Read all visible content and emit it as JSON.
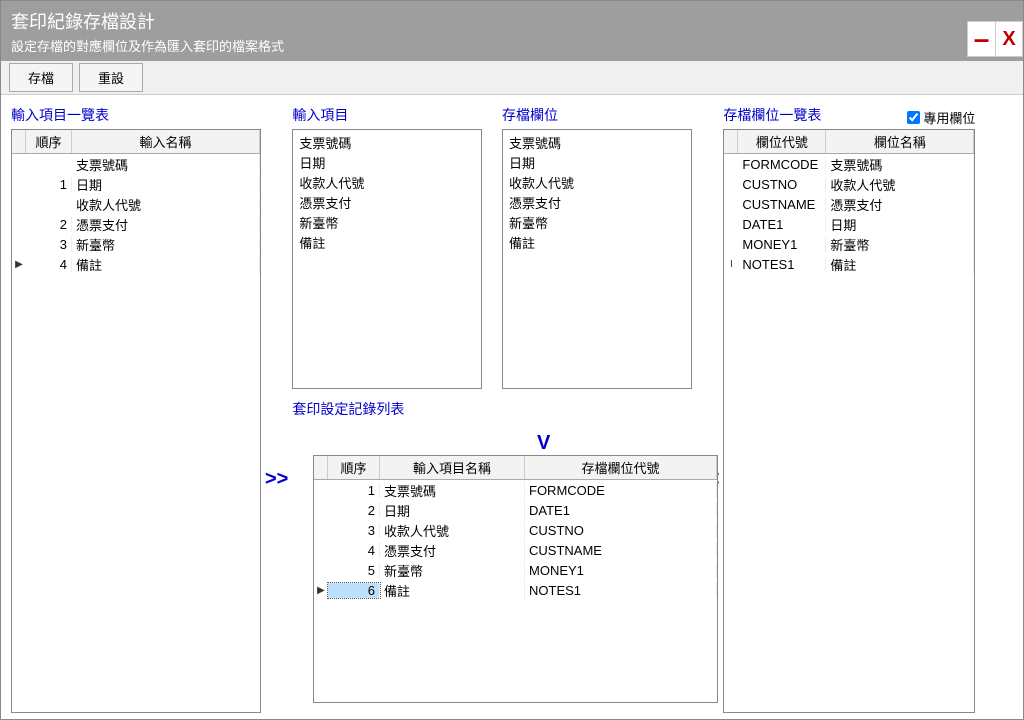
{
  "window": {
    "title": "套印紀錄存檔設計",
    "subtitle": "設定存檔的對應欄位及作為匯入套印的檔案格式",
    "minimize": "–",
    "close": "X"
  },
  "toolbar": {
    "save_label": "存檔",
    "reset_label": "重設"
  },
  "panels": {
    "input_list_title": "輸入項目一覽表",
    "input_items_title": "輸入項目",
    "save_fields_title": "存檔欄位",
    "field_list_title": "存檔欄位一覽表",
    "record_list_title": "套印設定記錄列表",
    "dedicated_field_label": "專用欄位",
    "dedicated_field_checked": true
  },
  "operators": {
    "push_right": ">>",
    "tilde": "~",
    "push_left": "<<",
    "down": "V"
  },
  "input_list": {
    "headers": {
      "order": "順序",
      "name": "輸入名稱"
    },
    "rows": [
      {
        "order": "",
        "name": "支票號碼",
        "ind": ""
      },
      {
        "order": "1",
        "name": "日期",
        "ind": ""
      },
      {
        "order": "",
        "name": "收款人代號",
        "ind": ""
      },
      {
        "order": "2",
        "name": "憑票支付",
        "ind": ""
      },
      {
        "order": "3",
        "name": "新臺幣",
        "ind": ""
      },
      {
        "order": "4",
        "name": "備註",
        "ind": "▶"
      }
    ]
  },
  "input_items": [
    "支票號碼",
    "日期",
    "收款人代號",
    "憑票支付",
    "新臺幣",
    "備註"
  ],
  "save_fields": [
    "支票號碼",
    "日期",
    "收款人代號",
    "憑票支付",
    "新臺幣",
    "備註"
  ],
  "field_list": {
    "headers": {
      "code": "欄位代號",
      "name": "欄位名稱"
    },
    "rows": [
      {
        "code": "FORMCODE",
        "name": "支票號碼",
        "ind": ""
      },
      {
        "code": "CUSTNO",
        "name": "收款人代號",
        "ind": ""
      },
      {
        "code": "CUSTNAME",
        "name": "憑票支付",
        "ind": ""
      },
      {
        "code": "DATE1",
        "name": "日期",
        "ind": ""
      },
      {
        "code": "MONEY1",
        "name": "新臺幣",
        "ind": ""
      },
      {
        "code": "NOTES1",
        "name": "備註",
        "ind": "I"
      }
    ]
  },
  "record_list": {
    "headers": {
      "order": "順序",
      "item": "輸入項目名稱",
      "code": "存檔欄位代號"
    },
    "rows": [
      {
        "order": "1",
        "item": "支票號碼",
        "code": "FORMCODE",
        "ind": ""
      },
      {
        "order": "2",
        "item": "日期",
        "code": "DATE1",
        "ind": ""
      },
      {
        "order": "3",
        "item": "收款人代號",
        "code": "CUSTNO",
        "ind": ""
      },
      {
        "order": "4",
        "item": "憑票支付",
        "code": "CUSTNAME",
        "ind": ""
      },
      {
        "order": "5",
        "item": "新臺幣",
        "code": "MONEY1",
        "ind": ""
      },
      {
        "order": "6",
        "item": "備註",
        "code": "NOTES1",
        "ind": "▶",
        "selected": true
      }
    ]
  }
}
